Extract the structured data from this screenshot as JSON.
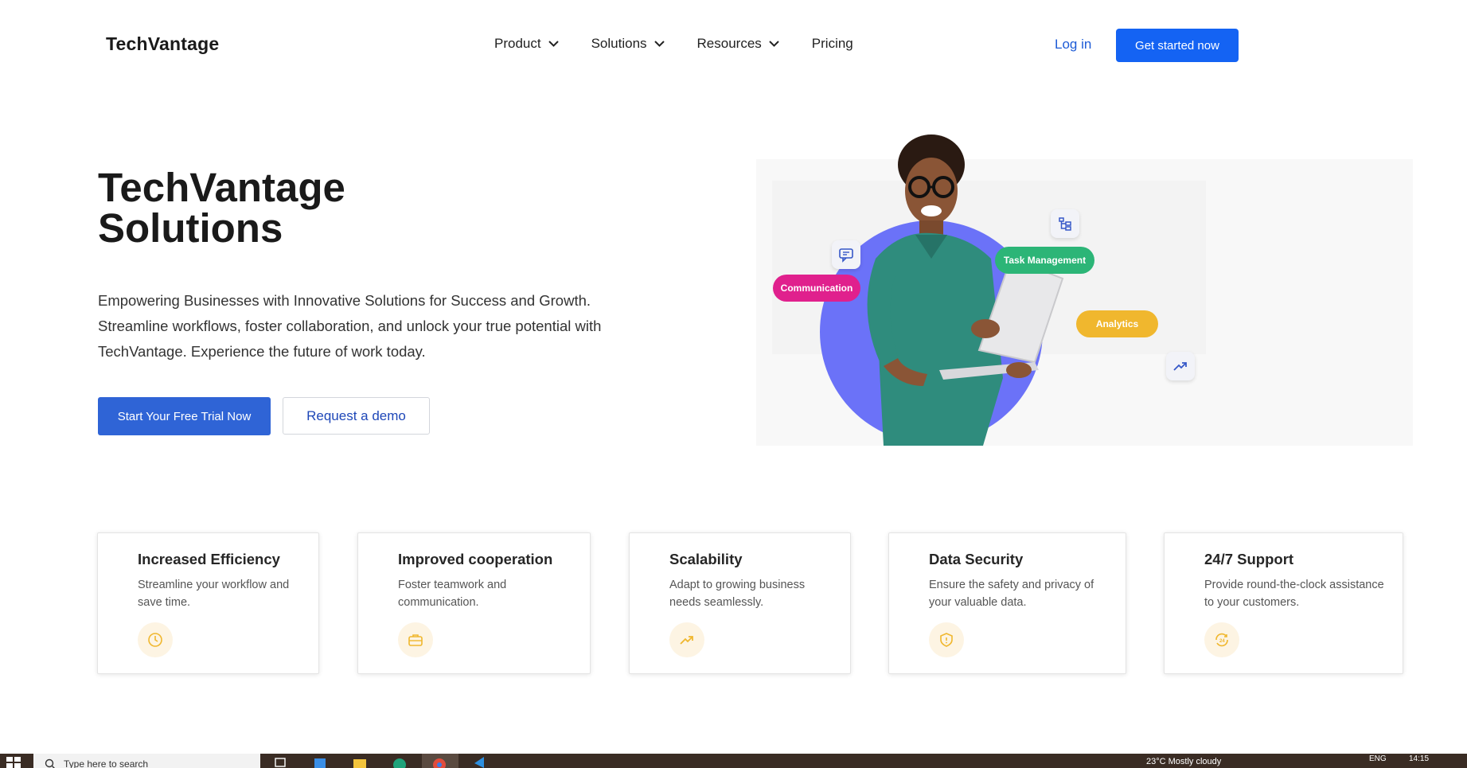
{
  "nav": {
    "logo": "TechVantage",
    "menu": [
      {
        "label": "Product",
        "has_dropdown": true
      },
      {
        "label": "Solutions",
        "has_dropdown": true
      },
      {
        "label": "Resources",
        "has_dropdown": true
      },
      {
        "label": "Pricing",
        "has_dropdown": false
      }
    ],
    "login": "Log in",
    "cta": "Get started now"
  },
  "hero": {
    "title_line1": "TechVantage",
    "title_line2": "Solutions",
    "description": "Empowering Businesses with Innovative Solutions for Success and Growth. Streamline workflows, foster collaboration, and unlock your true potential with TechVantage. Experience the future of work today.",
    "primary_button": "Start Your Free Trial Now",
    "secondary_button": "Request a demo",
    "illustration": {
      "chips": {
        "communication": "Communication",
        "task_management": "Task Management",
        "analytics": "Analytics"
      },
      "colors": {
        "blob": "#6b72f8",
        "communication": "#e0208d",
        "task_management": "#2cb577",
        "analytics": "#f0b72e"
      }
    }
  },
  "features": [
    {
      "title": "Increased Efficiency",
      "description": "Streamline your workflow and save time.",
      "icon": "clock-icon"
    },
    {
      "title": "Improved cooperation",
      "description": "Foster teamwork and communication.",
      "icon": "briefcase-icon"
    },
    {
      "title": "Scalability",
      "description": "Adapt to growing business needs seamlessly.",
      "icon": "trending-up-icon"
    },
    {
      "title": "Data Security",
      "description": "Ensure the safety and privacy of your valuable data.",
      "icon": "shield-icon"
    },
    {
      "title": "24/7 Support",
      "description": "Provide round-the-clock assistance to your customers.",
      "icon": "support-24-icon"
    }
  ],
  "taskbar": {
    "search_placeholder": "Type here to search",
    "weather": "23°C  Mostly cloudy",
    "language": "ENG",
    "time": "14:15"
  },
  "colors": {
    "brand_blue": "#1463f3",
    "primary_button": "#2f64d6",
    "link": "#1d5bd6",
    "feature_icon": "#f0b72e"
  }
}
